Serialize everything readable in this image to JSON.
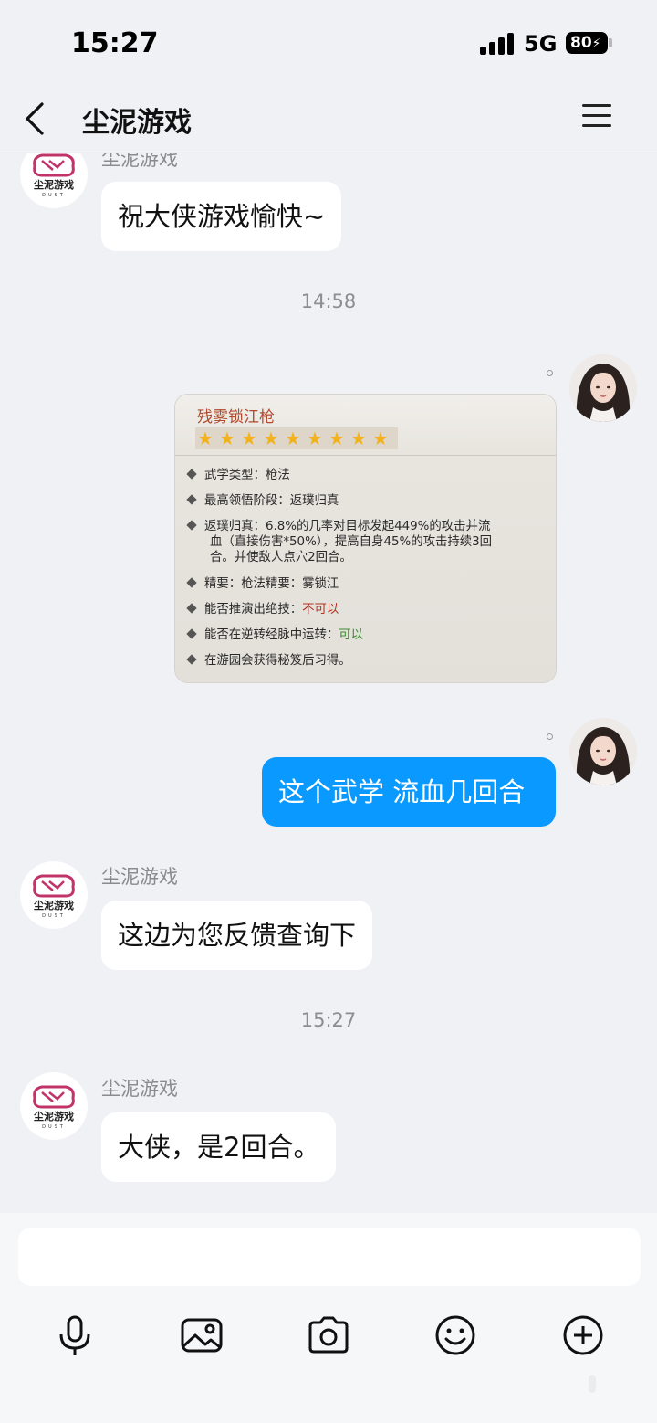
{
  "status_bar": {
    "time": "15:27",
    "network": "5G",
    "battery": "80"
  },
  "header": {
    "title": "尘泥游戏",
    "back_icon": "chevron-left-icon",
    "menu_icon": "hamburger-menu-icon"
  },
  "messages": [
    {
      "type": "incoming",
      "sender": "尘泥游戏",
      "text": "祝大侠游戏愉快~"
    },
    {
      "type": "timestamp",
      "text": "14:58"
    },
    {
      "type": "outgoing-image",
      "card": {
        "title": "残雾锁江枪",
        "stars": 9,
        "lines": [
          {
            "label": "武学类型：",
            "value": "枪法"
          },
          {
            "label": "最高领悟阶段：",
            "value": "返璞归真"
          },
          {
            "label": "返璞归真：",
            "value": "6.8%的几率对目标发起449%的攻击并流",
            "cont": [
              "血（直接伤害*50%），提高自身45%的攻击持续3回",
              "合。并使敌人点穴2回合。"
            ]
          },
          {
            "label": "精要：",
            "value": "枪法精要：雾锁江"
          },
          {
            "label": "能否推演出绝技：",
            "value": "不可以"
          },
          {
            "label": "能否在逆转经脉中运转：",
            "value": "可以"
          },
          {
            "label": "",
            "value": "在游园会获得秘笈后习得。"
          }
        ]
      }
    },
    {
      "type": "outgoing",
      "text": "这个武学 流血几回合"
    },
    {
      "type": "incoming",
      "sender": "尘泥游戏",
      "text": "这边为您反馈查询下"
    },
    {
      "type": "timestamp",
      "text": "15:27"
    },
    {
      "type": "incoming",
      "sender": "尘泥游戏",
      "text": "大侠，是2回合。"
    }
  ],
  "avatar": {
    "logo_text": "尘泥游戏",
    "logo_sub": "DUST",
    "brand_color": "#c0346a"
  },
  "toolbar": {
    "input_placeholder": "",
    "icons": [
      "microphone-icon",
      "image-icon",
      "camera-icon",
      "emoji-icon",
      "plus-circle-icon"
    ]
  },
  "colors": {
    "outgoing_bubble": "#0a99ff",
    "incoming_bubble": "#ffffff",
    "background": "#f0f1f5"
  }
}
